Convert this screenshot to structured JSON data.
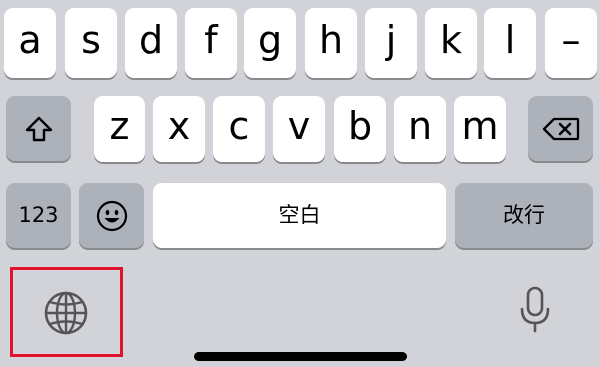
{
  "keyboard": {
    "row1": [
      "a",
      "s",
      "d",
      "f",
      "g",
      "h",
      "j",
      "k",
      "l",
      "–"
    ],
    "row2": [
      "z",
      "x",
      "c",
      "v",
      "b",
      "n",
      "m"
    ],
    "numbers_label": "123",
    "space_label": "空白",
    "return_label": "改行"
  },
  "icons": {
    "shift": "shift-icon",
    "backspace": "backspace-icon",
    "emoji": "emoji-icon",
    "globe": "globe-icon",
    "mic": "microphone-icon"
  },
  "colors": {
    "background": "#d1d3d9",
    "key": "#ffffff",
    "dark_key": "#acb1ba",
    "highlight_border": "#e0132a"
  }
}
